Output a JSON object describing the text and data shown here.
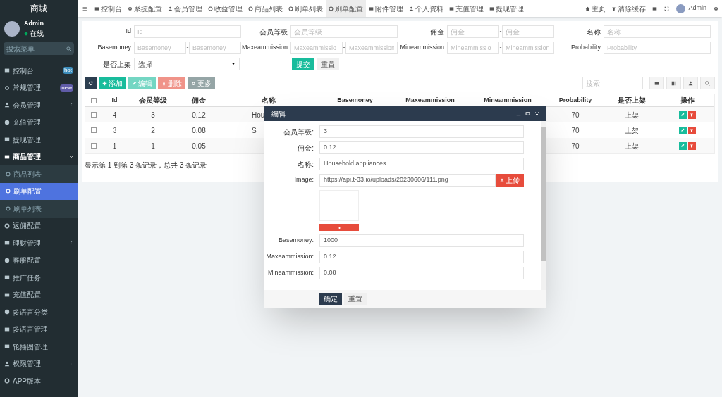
{
  "sidebar": {
    "brand": "商城",
    "user": {
      "name": "Admin",
      "status": "在线"
    },
    "search": {
      "placeholder": "搜索菜单"
    },
    "items": [
      {
        "label": "控制台",
        "badge": {
          "text": "hot",
          "color": "#3c8dbc"
        },
        "expandable": false,
        "expanded": false,
        "selected": false
      },
      {
        "label": "常规管理",
        "badge": {
          "text": "new",
          "color": "#605ca8"
        },
        "expandable": false,
        "expanded": false,
        "selected": false
      },
      {
        "label": "会员管理",
        "expandable": true,
        "expanded": false,
        "selected": false
      },
      {
        "label": "充值管理",
        "expandable": false,
        "expanded": false,
        "selected": false
      },
      {
        "label": "提现管理",
        "expandable": false,
        "expanded": false,
        "selected": false
      },
      {
        "label": "商品管理",
        "expandable": true,
        "expanded": true,
        "selected": false,
        "children": [
          {
            "label": "商品列表",
            "selected": false
          },
          {
            "label": "刷单配置",
            "selected": true
          },
          {
            "label": "刷单列表",
            "selected": false
          }
        ]
      },
      {
        "label": "返佣配置",
        "expandable": false,
        "expanded": false,
        "selected": false
      },
      {
        "label": "理财管理",
        "expandable": true,
        "expanded": false,
        "selected": false
      },
      {
        "label": "客服配置",
        "expandable": false,
        "expanded": false,
        "selected": false
      },
      {
        "label": "推广任务",
        "expandable": false,
        "expanded": false,
        "selected": false
      },
      {
        "label": "充值配置",
        "expandable": false,
        "expanded": false,
        "selected": false
      },
      {
        "label": "多语言分类",
        "expandable": false,
        "expanded": false,
        "selected": false
      },
      {
        "label": "多语言管理",
        "expandable": false,
        "expanded": false,
        "selected": false
      },
      {
        "label": "轮播图管理",
        "expandable": false,
        "expanded": false,
        "selected": false
      },
      {
        "label": "权限管理",
        "expandable": true,
        "expanded": false,
        "selected": false
      },
      {
        "label": "APP版本",
        "expandable": false,
        "expanded": false,
        "selected": false
      }
    ]
  },
  "topbar": {
    "menu_icon": "≡",
    "tabs": [
      {
        "label": "控制台",
        "selected": false
      },
      {
        "label": "系统配置",
        "selected": false
      },
      {
        "label": "会员管理",
        "selected": false
      },
      {
        "label": "收益管理",
        "selected": false
      },
      {
        "label": "商品列表",
        "selected": false
      },
      {
        "label": "刷单列表",
        "selected": false
      },
      {
        "label": "刷单配置",
        "selected": true
      },
      {
        "label": "附件管理",
        "selected": false
      },
      {
        "label": "个人资料",
        "selected": false
      },
      {
        "label": "充值管理",
        "selected": false
      },
      {
        "label": "提现管理",
        "selected": false
      }
    ],
    "home": "主页",
    "clear_cache": "清除缓存",
    "user": "Admin"
  },
  "filter": {
    "fields": [
      {
        "kind": "text",
        "label": "Id",
        "placeholder": "Id"
      },
      {
        "kind": "text",
        "label": "会员等级",
        "placeholder": "会员等级"
      },
      {
        "kind": "range",
        "label": "佣金",
        "placeholder": "佣金",
        "separator": "-",
        "placeholder_to": "佣金"
      },
      {
        "kind": "text",
        "label": "名称",
        "placeholder": "名称"
      },
      {
        "kind": "range",
        "label": "Basemoney",
        "placeholder": "Basemoney",
        "separator": "-",
        "placeholder_to": "Basemoney"
      },
      {
        "kind": "range",
        "label": "Maxeammission",
        "placeholder": "Maxeammissio",
        "separator": "-",
        "placeholder_to": "Maxeammission"
      },
      {
        "kind": "range",
        "label": "Mineammission",
        "placeholder": "Mineammissio",
        "separator": "-",
        "placeholder_to": "Mineammission"
      },
      {
        "kind": "text",
        "label": "Probability",
        "placeholder": "Probability"
      },
      {
        "kind": "select",
        "label": "是否上架",
        "value": "选择"
      }
    ],
    "submit": "提交",
    "reset": "重置"
  },
  "toolbar": {
    "buttons": [
      {
        "kind": "refresh",
        "disabled": false
      },
      {
        "kind": "add",
        "label": "添加",
        "disabled": false
      },
      {
        "kind": "edit",
        "label": "编辑",
        "disabled": true
      },
      {
        "kind": "delete",
        "label": "删除",
        "disabled": true
      },
      {
        "kind": "more",
        "label": "更多",
        "disabled": false
      }
    ],
    "search": {
      "placeholder": "搜索"
    }
  },
  "table": {
    "columns": [
      "Id",
      "会员等级",
      "佣金",
      "名称",
      "Basemoney",
      "Maxeammission",
      "Mineammission",
      "Probability",
      "是否上架",
      "操作"
    ],
    "header_checked": false,
    "rows": [
      {
        "checked": false,
        "cells": [
          "4",
          "3",
          "0.12",
          "Hou",
          "",
          "",
          "",
          "70",
          "上架"
        ]
      },
      {
        "checked": false,
        "cells": [
          "3",
          "2",
          "0.08",
          "S",
          "",
          "",
          "",
          "70",
          "上架"
        ]
      },
      {
        "checked": false,
        "cells": [
          "1",
          "1",
          "0.05",
          "",
          "",
          "",
          "",
          "70",
          "上架"
        ]
      }
    ],
    "summary": "显示第 1 到第 3 条记录，总共 3 条记录"
  },
  "dialog": {
    "title": "编辑",
    "fields": [
      {
        "kind": "text",
        "label": "会员等级:",
        "value": "3"
      },
      {
        "kind": "text",
        "label": "佣金:",
        "value": "0.12"
      },
      {
        "kind": "text",
        "label": "名称:",
        "value": "Household appliances"
      },
      {
        "kind": "upload",
        "label": "Image:",
        "value": "https://api.t-33.io/uploads/20230606/111.png",
        "button": "上传"
      },
      {
        "kind": "preview"
      },
      {
        "kind": "text",
        "label": "Basemoney:",
        "value": "1000"
      },
      {
        "kind": "text",
        "label": "Maxeammission:",
        "value": "0.12"
      },
      {
        "kind": "text",
        "label": "Mineammission:",
        "value": "0.08"
      }
    ],
    "confirm": "确定",
    "reset": "重置"
  }
}
